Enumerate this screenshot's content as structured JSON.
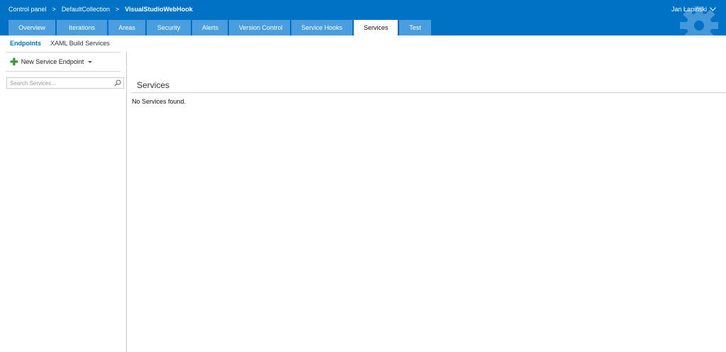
{
  "breadcrumb": {
    "items": [
      "Control panel",
      "DefaultCollection",
      "VisualStudioWebHook"
    ],
    "separator": ">"
  },
  "user": {
    "name": "Jan Łapiński"
  },
  "tabs": [
    {
      "label": "Overview"
    },
    {
      "label": "Iterations"
    },
    {
      "label": "Areas"
    },
    {
      "label": "Security"
    },
    {
      "label": "Alerts"
    },
    {
      "label": "Version Control"
    },
    {
      "label": "Service Hooks"
    },
    {
      "label": "Services",
      "active": true
    },
    {
      "label": "Test"
    }
  ],
  "subnav": {
    "items": [
      {
        "label": "Endpoints",
        "active": true
      },
      {
        "label": "XAML Build Services"
      }
    ]
  },
  "left": {
    "new_endpoint_label": "New Service Endpoint",
    "new_endpoint_icon": "plus-icon",
    "search_placeholder": "Search Services..."
  },
  "main": {
    "title": "Services",
    "empty_message": "No Services found."
  },
  "colors": {
    "header_bg": "#0072c6",
    "tab_bg": "#4a9ede",
    "tab_active_bg": "#ffffff",
    "accent": "#0072c6",
    "plus": "#3a9a3a"
  }
}
